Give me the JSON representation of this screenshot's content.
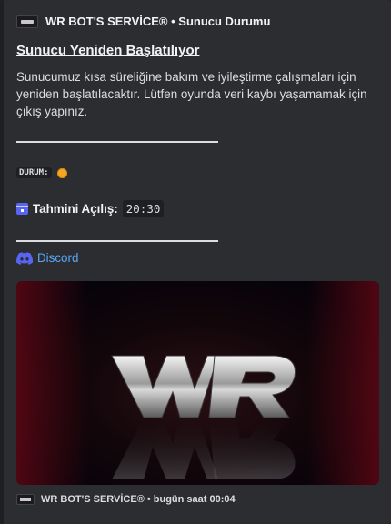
{
  "author": {
    "name": "WR BOT'S SERVİCE® • Sunucu Durumu",
    "icon": "wr-logo-icon"
  },
  "title": "Sunucu Yeniden Başlatılıyor",
  "description": "Sunucumuz kısa süreliğine bakım ve iyileştirme çalışmaları için yeniden başlatılacaktır. Lütfen oyunda veri kaybı yaşamamak için çıkış yapınız.",
  "divider": "_______________________________",
  "status": {
    "label": "DURUM:",
    "dot_color": "#f5a623"
  },
  "eta": {
    "label": "Tahmini Açılış:",
    "time": "20:30",
    "icon": "calendar-icon"
  },
  "link": {
    "label": "Discord",
    "icon": "discord-icon"
  },
  "banner": {
    "logo_text": "WR"
  },
  "footer": {
    "text": "WR BOT'S SERVİCE® • bugün saat 00:04"
  }
}
